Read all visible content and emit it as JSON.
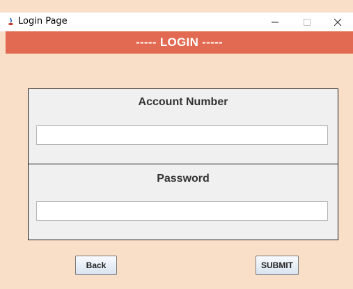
{
  "window": {
    "title": "Login Page",
    "controls": {
      "minimize": "—",
      "maximize": "☐",
      "close": "✕"
    }
  },
  "header": {
    "banner_text": "----- LOGIN -----"
  },
  "form": {
    "account": {
      "label": "Account Number",
      "value": "",
      "placeholder": ""
    },
    "password": {
      "label": "Password",
      "value": "",
      "placeholder": ""
    }
  },
  "buttons": {
    "back_label": "Back",
    "submit_label": "SUBMIT"
  },
  "colors": {
    "background": "#f9dec8",
    "banner": "#e26a52",
    "panel": "#f0f0f0"
  },
  "icons": {
    "app": "java-coffee-icon"
  }
}
